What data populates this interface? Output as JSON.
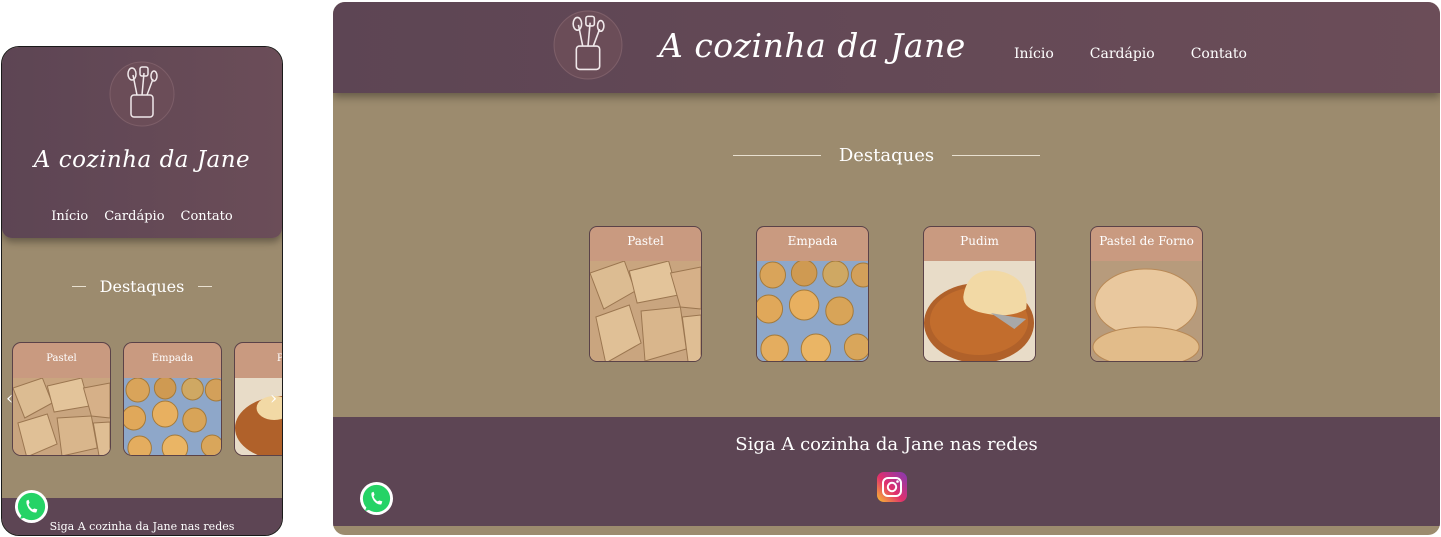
{
  "brand": "A cozinha da Jane",
  "nav": [
    "Início",
    "Cardápio",
    "Contato"
  ],
  "highlights_title": "Destaques",
  "cards": [
    {
      "title": "Pastel",
      "image": "fried-pastel"
    },
    {
      "title": "Empada",
      "image": "empada"
    },
    {
      "title": "Pudim",
      "image": "pudim"
    },
    {
      "title": "Pastel de Forno",
      "image": "baked-pastel"
    }
  ],
  "mobile_partial_card": "Pu",
  "footer_text": "Siga A cozinha da Jane nas redes",
  "icons": {
    "logo": "utensils-jar-icon",
    "whatsapp": "whatsapp-icon",
    "instagram": "instagram-icon",
    "carousel_prev": "chevron-left-icon",
    "carousel_next": "chevron-right-icon"
  },
  "colors": {
    "header": "#5d4554",
    "background": "#9c8b6e",
    "card_header": "#c99a80",
    "footer": "#5d4554",
    "whatsapp": "#25d366"
  }
}
